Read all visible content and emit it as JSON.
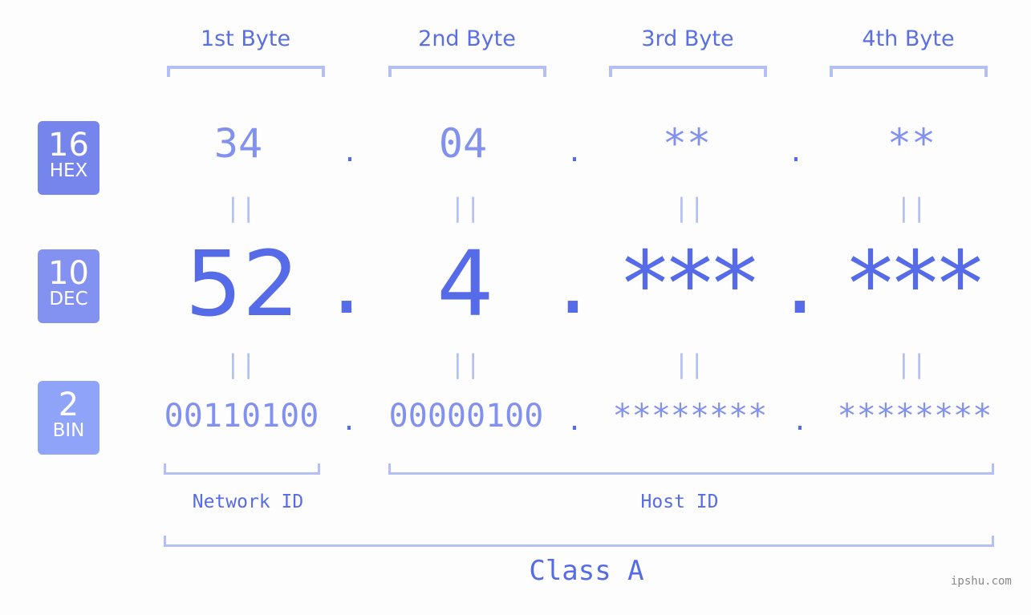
{
  "bytes": [
    {
      "title": "1st Byte",
      "hex": "34",
      "dec": "52",
      "bin": "00110100"
    },
    {
      "title": "2nd Byte",
      "hex": "04",
      "dec": "4",
      "bin": "00000100"
    },
    {
      "title": "3rd Byte",
      "hex": "**",
      "dec": "***",
      "bin": "********"
    },
    {
      "title": "4th Byte",
      "hex": "**",
      "dec": "***",
      "bin": "********"
    }
  ],
  "badges": {
    "hex": {
      "num": "16",
      "label": "HEX"
    },
    "dec": {
      "num": "10",
      "label": "DEC"
    },
    "bin": {
      "num": "2",
      "label": "BIN"
    }
  },
  "separator": ".",
  "equals": "||",
  "network_label": "Network ID",
  "host_label": "Host ID",
  "class_label": "Class A",
  "watermark": "ipshu.com",
  "colors": {
    "accent": "#566be8",
    "light_accent": "#8391ee",
    "bracket": "#b4bff5",
    "hex_badge": "#7585ec",
    "dec_badge": "#8391f0",
    "bin_badge": "#8fa4f8"
  }
}
